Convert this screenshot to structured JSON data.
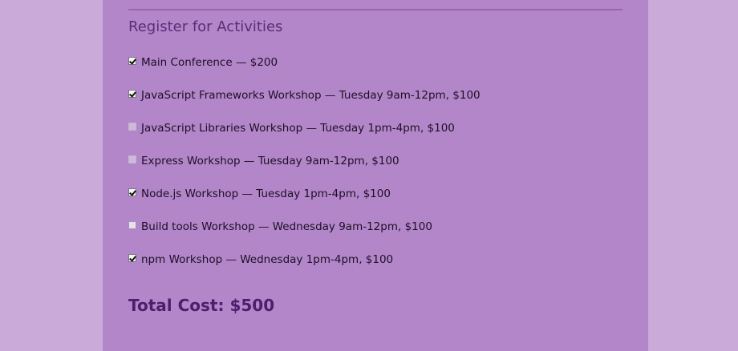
{
  "section": {
    "title": "Register for Activities"
  },
  "activities": [
    {
      "label": "Main Conference — $200",
      "checked": true,
      "disabled": false
    },
    {
      "label": "JavaScript Frameworks Workshop — Tuesday 9am-12pm, $100",
      "checked": true,
      "disabled": false
    },
    {
      "label": "JavaScript Libraries Workshop — Tuesday 1pm-4pm, $100",
      "checked": false,
      "disabled": true
    },
    {
      "label": "Express Workshop — Tuesday 9am-12pm, $100",
      "checked": false,
      "disabled": true
    },
    {
      "label": "Node.js Workshop — Tuesday 1pm-4pm, $100",
      "checked": true,
      "disabled": false
    },
    {
      "label": "Build tools Workshop — Wednesday 9am-12pm, $100",
      "checked": false,
      "disabled": false
    },
    {
      "label": "npm Workshop — Wednesday 1pm-4pm, $100",
      "checked": true,
      "disabled": false
    }
  ],
  "total": {
    "label": "Total Cost: $500"
  },
  "colors": {
    "page_background": "#c9aad9",
    "panel_background": "#b386ca",
    "heading": "#5a2d78",
    "total": "#4b1f6b"
  }
}
